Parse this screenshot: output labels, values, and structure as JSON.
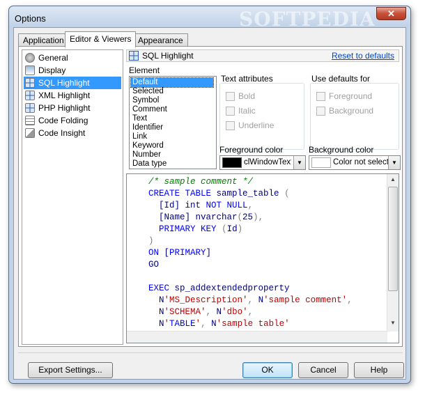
{
  "window": {
    "title": "Options",
    "watermark": "SOFTPEDIA",
    "close_glyph": "✕"
  },
  "tabs": [
    {
      "label": "Application"
    },
    {
      "label": "Editor & Viewers",
      "active": true
    },
    {
      "label": "Appearance"
    }
  ],
  "nav": {
    "items": [
      {
        "label": "General",
        "icon": "gear-icon"
      },
      {
        "label": "Display",
        "icon": "display-icon"
      },
      {
        "label": "SQL Highlight",
        "icon": "grid-icon",
        "selected": true
      },
      {
        "label": "XML Highlight",
        "icon": "grid-icon"
      },
      {
        "label": "PHP Highlight",
        "icon": "grid-icon"
      },
      {
        "label": "Code Folding",
        "icon": "folding-icon"
      },
      {
        "label": "Code Insight",
        "icon": "insight-icon"
      }
    ]
  },
  "panel": {
    "title": "SQL Highlight",
    "reset_link": "Reset to defaults",
    "element_label": "Element",
    "elements": [
      "Default",
      "Selected",
      "Symbol",
      "Comment",
      "Text",
      "Identifier",
      "Link",
      "Keyword",
      "Number",
      "Data type"
    ],
    "selected_element": "Default",
    "text_attributes": {
      "label": "Text attributes",
      "options": [
        {
          "label": "Bold"
        },
        {
          "label": "Italic"
        },
        {
          "label": "Underline"
        }
      ]
    },
    "use_defaults": {
      "label": "Use defaults for",
      "options": [
        {
          "label": "Foreground"
        },
        {
          "label": "Background"
        }
      ]
    },
    "foreground": {
      "label": "Foreground color",
      "value": "clWindowText",
      "swatch": "#000000"
    },
    "background": {
      "label": "Background color",
      "value": "Color not selected",
      "swatch": "#ffffff"
    }
  },
  "code_preview": {
    "lines": [
      "/* sample comment */",
      "CREATE TABLE sample_table (",
      "  [Id] int NOT NULL,",
      "  [Name] nvarchar(25),",
      "  PRIMARY KEY (Id)",
      ")",
      "ON [PRIMARY]",
      "GO",
      "",
      "EXEC sp_addextendedproperty",
      "  N'MS_Description', N'sample comment',",
      "  N'SCHEMA', N'dbo',",
      "  N'TABLE', N'sample table'"
    ]
  },
  "footer": {
    "export": "Export Settings...",
    "ok": "OK",
    "cancel": "Cancel",
    "help": "Help"
  },
  "colors": {
    "selection": "#3399ff",
    "link": "#0044cc",
    "keyword": "#0000ff",
    "comment": "#008000",
    "string": "#c00000"
  }
}
